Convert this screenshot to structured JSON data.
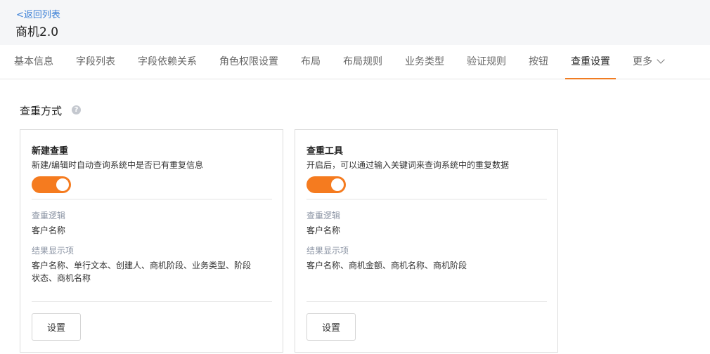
{
  "header": {
    "back_label": "<返回列表",
    "title": "商机2.0"
  },
  "tabs": [
    {
      "label": "基本信息"
    },
    {
      "label": "字段列表"
    },
    {
      "label": "字段依赖关系"
    },
    {
      "label": "角色权限设置"
    },
    {
      "label": "布局"
    },
    {
      "label": "布局规则"
    },
    {
      "label": "业务类型"
    },
    {
      "label": "验证规则"
    },
    {
      "label": "按钮"
    },
    {
      "label": "查重设置"
    },
    {
      "label": "更多"
    }
  ],
  "active_tab": "查重设置",
  "section": {
    "title": "查重方式",
    "help": "?"
  },
  "cards": [
    {
      "title": "新建查重",
      "desc": "新建/编辑时自动查询系统中是否已有重复信息",
      "enabled": true,
      "logic_label": "查重逻辑",
      "logic_value": "客户名称",
      "result_label": "结果显示项",
      "result_value": "客户名称、单行文本、创建人、商机阶段、业务类型、阶段状态、商机名称",
      "button_label": "设置"
    },
    {
      "title": "查重工具",
      "desc": "开启后，可以通过输入关键词来查询系统中的重复数据",
      "enabled": true,
      "logic_label": "查重逻辑",
      "logic_value": "客户名称",
      "result_label": "结果显示项",
      "result_value": "客户名称、商机金额、商机名称、商机阶段",
      "button_label": "设置"
    }
  ],
  "colors": {
    "accent": "#f57b1f",
    "link": "#3a7fd6"
  }
}
